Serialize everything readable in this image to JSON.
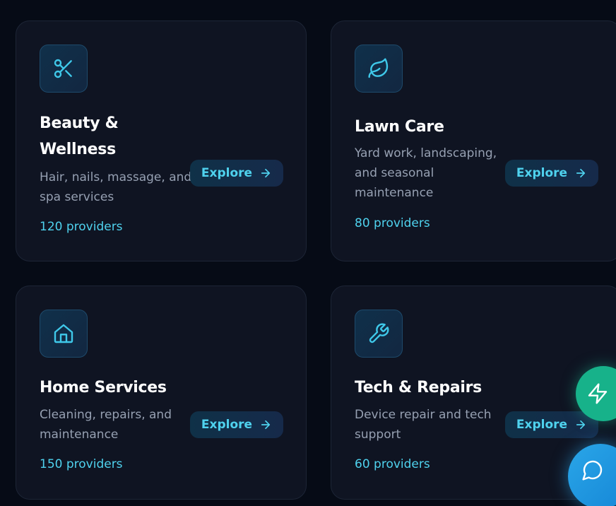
{
  "colors": {
    "accent": "#4fd2ee",
    "card_background": "#0f1422",
    "page_background": "#060b16",
    "fab_green": "#17b28a",
    "fab_blue": "#2aa6e8"
  },
  "categories": [
    {
      "icon": "scissors-icon",
      "title_line1": "Beauty &",
      "title_line2": "Wellness",
      "description_line1": "Hair, nails, massage, and",
      "description_line2": "spa services",
      "description_line3": "",
      "providers": "120 providers",
      "explore_label": "Explore"
    },
    {
      "icon": "leaf-icon",
      "title_line1": "Lawn Care",
      "title_line2": "",
      "description_line1": "Yard work, landscaping,",
      "description_line2": "and seasonal",
      "description_line3": "maintenance",
      "providers": "80 providers",
      "explore_label": "Explore"
    },
    {
      "icon": "home-icon",
      "title_line1": "Home Services",
      "title_line2": "",
      "description_line1": "Cleaning, repairs, and",
      "description_line2": "maintenance",
      "description_line3": "",
      "providers": "150 providers",
      "explore_label": "Explore"
    },
    {
      "icon": "wrench-icon",
      "title_line1": "Tech & Repairs",
      "title_line2": "",
      "description_line1": "Device repair and tech",
      "description_line2": "support",
      "description_line3": "",
      "providers": "60 providers",
      "explore_label": "Explore"
    }
  ],
  "floating_actions": [
    {
      "icon": "lightning-icon"
    },
    {
      "icon": "chat-bubble-icon"
    }
  ]
}
